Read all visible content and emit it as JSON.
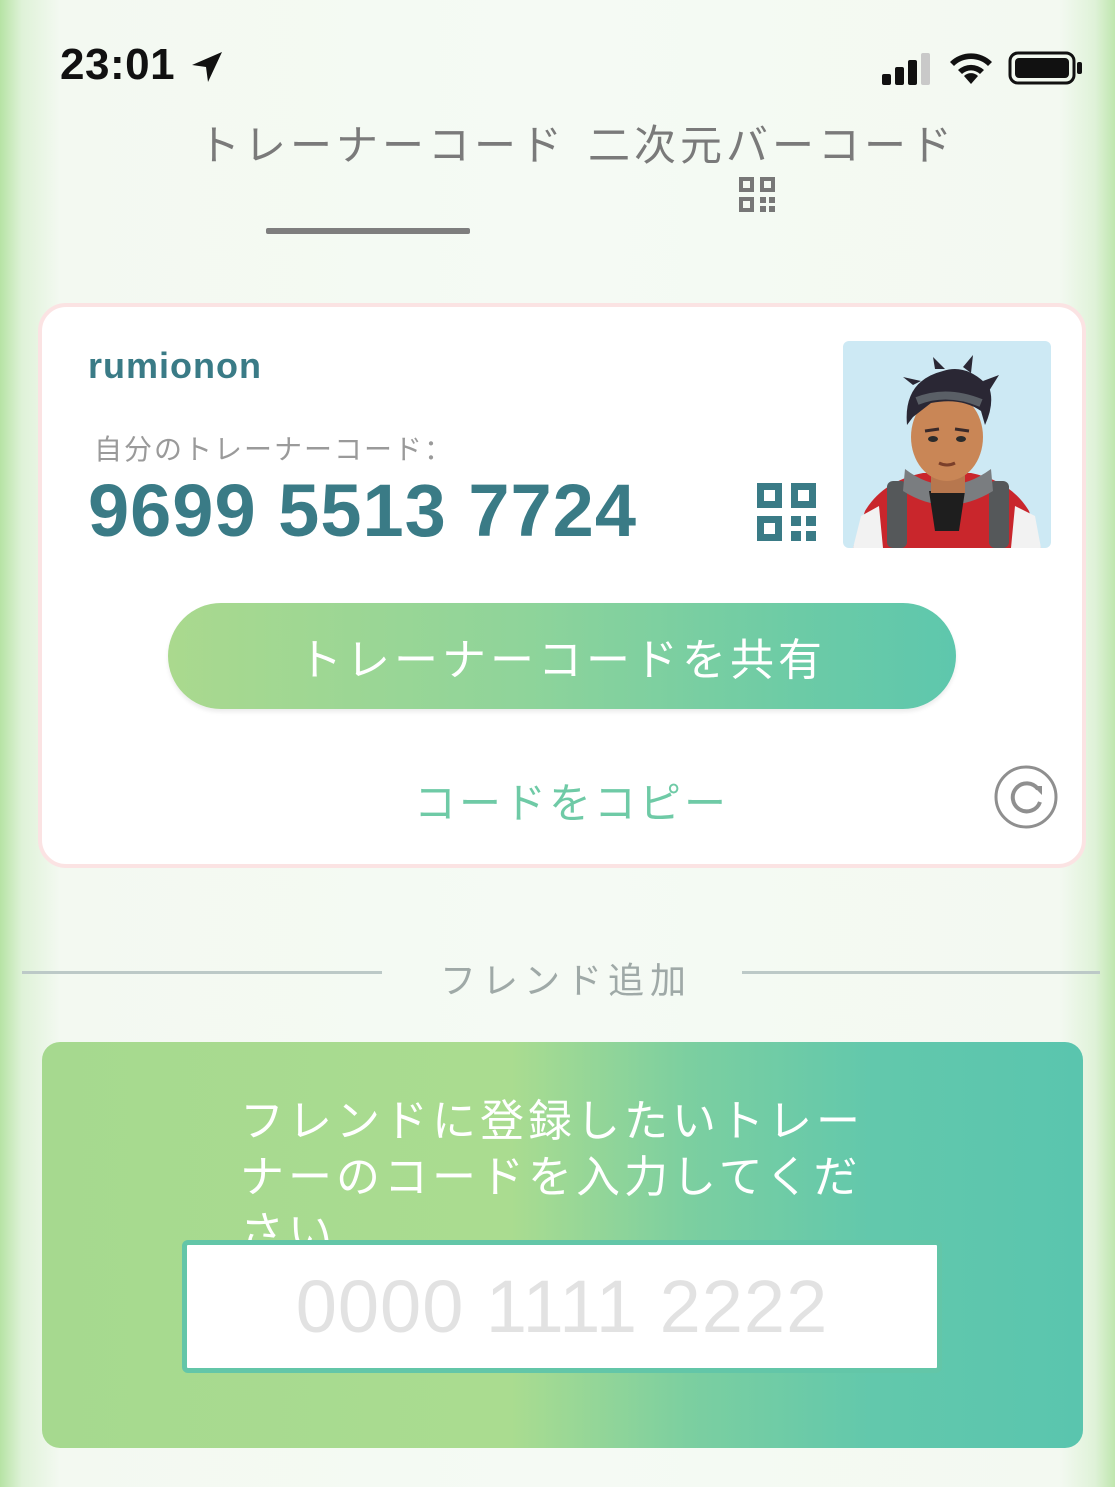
{
  "status_bar": {
    "time": "23:01",
    "icons": [
      "location-arrow-icon",
      "cellular-signal-icon",
      "wifi-icon",
      "battery-icon"
    ]
  },
  "tabs": [
    {
      "label": "トレーナーコード",
      "selected": true
    },
    {
      "label": "二次元バーコード",
      "selected": false,
      "icon": "qr-code-icon"
    }
  ],
  "trainer_card": {
    "username": "rumionon",
    "code_label": "自分のトレーナーコード：",
    "code": "9699 5513 7724",
    "code_icon": "qr-code-icon",
    "avatar": "trainer-avatar",
    "share_button": "トレーナーコードを共有",
    "copy_link": "コードをコピー",
    "refresh_icon": "refresh-icon"
  },
  "friend_add": {
    "section_title": "フレンド追加",
    "instruction": "フレンドに登録したいトレーナーのコードを入力してください",
    "input_value": "",
    "input_placeholder": "0000 1111 2222"
  },
  "colors": {
    "accent_teal": "#3a7b86",
    "button_start": "#aad98e",
    "button_end": "#5ec7ad",
    "card_border": "#fbe3e3"
  }
}
